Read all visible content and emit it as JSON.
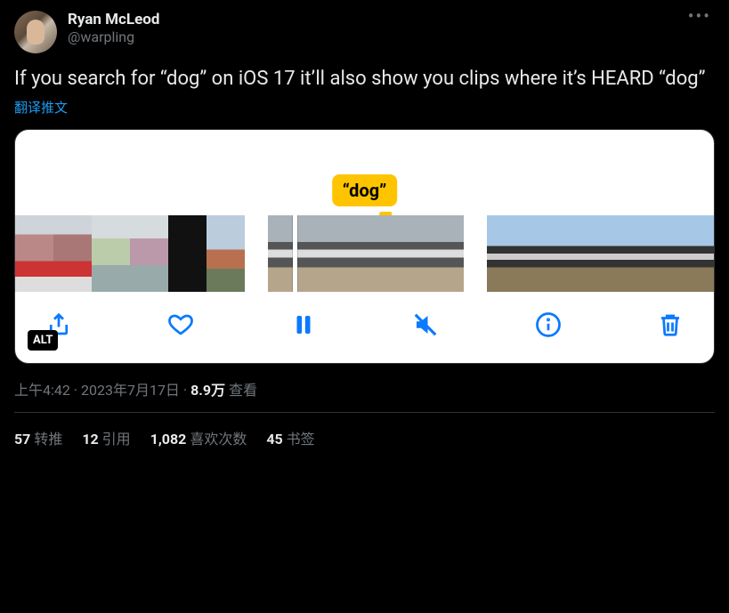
{
  "author": {
    "display_name": "Ryan McLeod",
    "handle": "@warpling"
  },
  "tweet_text": "If you search for “dog” on iOS 17 it’ll also show you clips where it’s HEARD “dog”",
  "translate_label": "翻译推文",
  "media": {
    "caption_badge": "“dog”",
    "alt_badge": "ALT"
  },
  "meta": {
    "time": "上午4:42",
    "dot1": " · ",
    "date": "2023年7月17日",
    "dot2": " · ",
    "views_num": "8.9万",
    "views_label": " 查看"
  },
  "stats": {
    "retweets": {
      "num": "57",
      "label": " 转推"
    },
    "quotes": {
      "num": "12",
      "label": " 引用"
    },
    "likes": {
      "num": "1,082",
      "label": " 喜欢次数"
    },
    "bookmarks": {
      "num": "45",
      "label": " 书签"
    }
  }
}
